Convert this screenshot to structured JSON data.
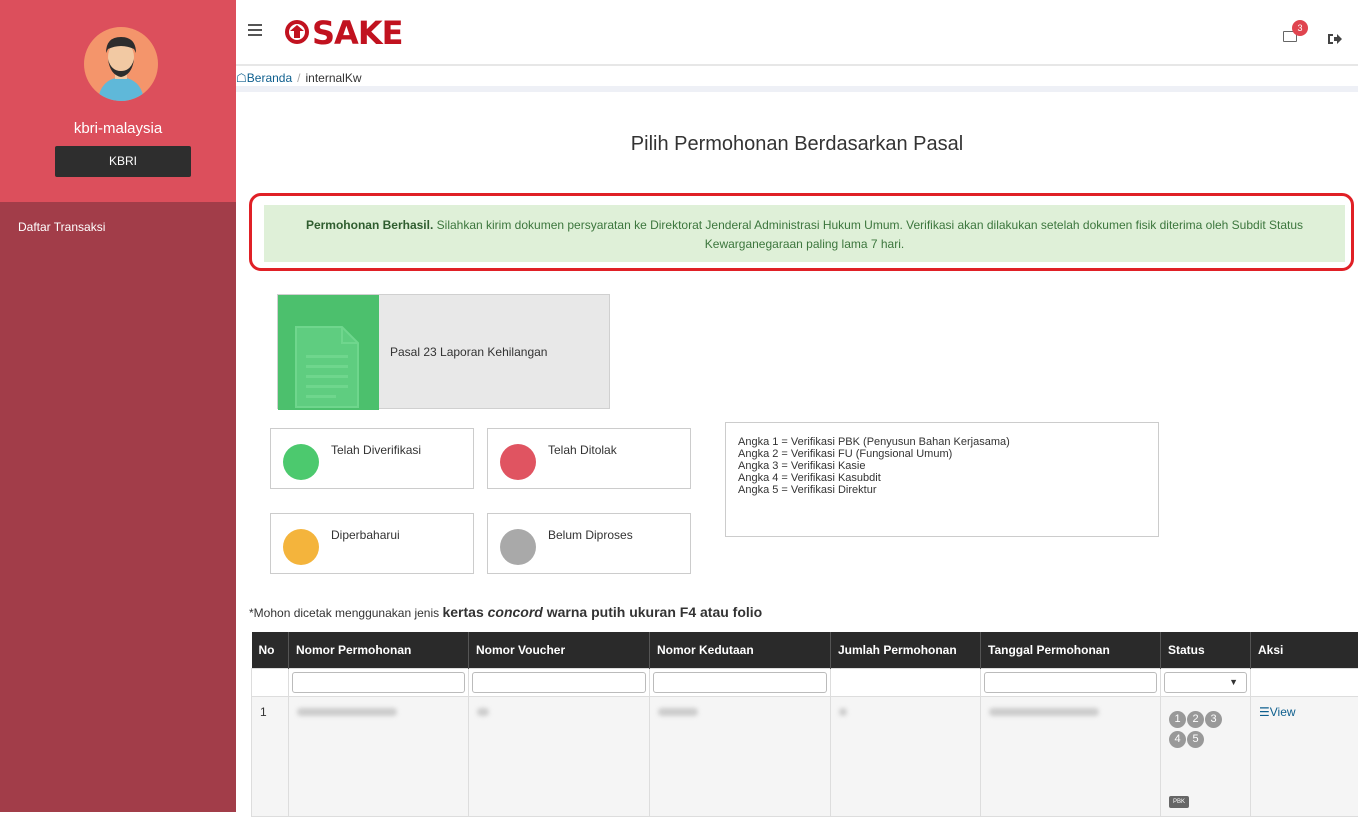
{
  "sidebar": {
    "username": "kbri-malaysia",
    "role": "KBRI",
    "menu": [
      {
        "label": "Daftar Transaksi"
      }
    ]
  },
  "header": {
    "logo_text": "SAKE",
    "notification_count": "3"
  },
  "breadcrumb": {
    "home": "Beranda",
    "current": "internalKw"
  },
  "page_title": "Pilih Permohonan Berdasarkan Pasal",
  "alert": {
    "bold": "Permohonan Berhasil.",
    "text": " Silahkan kirim dokumen persyaratan ke Direktorat Jenderal Administrasi Hukum Umum. Verifikasi akan dilakukan setelah dokumen fisik diterima oleh Subdit Status Kewarganegaraan paling lama 7 hari."
  },
  "pasal_card": {
    "label": "Pasal 23 Laporan Kehilangan"
  },
  "legend": [
    {
      "label": "Telah Diverifikasi",
      "color": "#4cc96e"
    },
    {
      "label": "Telah Ditolak",
      "color": "#e05461"
    },
    {
      "label": "Diperbaharui",
      "color": "#f4b43c"
    },
    {
      "label": "Belum Diproses",
      "color": "#a9a9a9"
    }
  ],
  "angka": [
    "Angka 1 = Verifikasi PBK (Penyusun Bahan Kerjasama)",
    "Angka 2 = Verifikasi FU (Fungsional Umum)",
    "Angka 3 = Verifikasi Kasie",
    "Angka 4 = Verifikasi Kasubdit",
    "Angka 5 = Verifikasi Direktur"
  ],
  "note": {
    "prefix": "*Mohon dicetak menggunakan jenis ",
    "bold1": "kertas ",
    "italic": "concord",
    "bold2": " warna putih ukuran F4 atau folio"
  },
  "table": {
    "headers": [
      "No",
      "Nomor Permohonan",
      "Nomor Voucher",
      "Nomor Kedutaan",
      "Jumlah Permohonan",
      "Tanggal Permohonan",
      "Status",
      "Aksi"
    ],
    "rows": [
      {
        "no": "1",
        "steps": [
          "1",
          "2",
          "3",
          "4",
          "5"
        ],
        "badge": "PBK",
        "action": "View"
      }
    ]
  }
}
